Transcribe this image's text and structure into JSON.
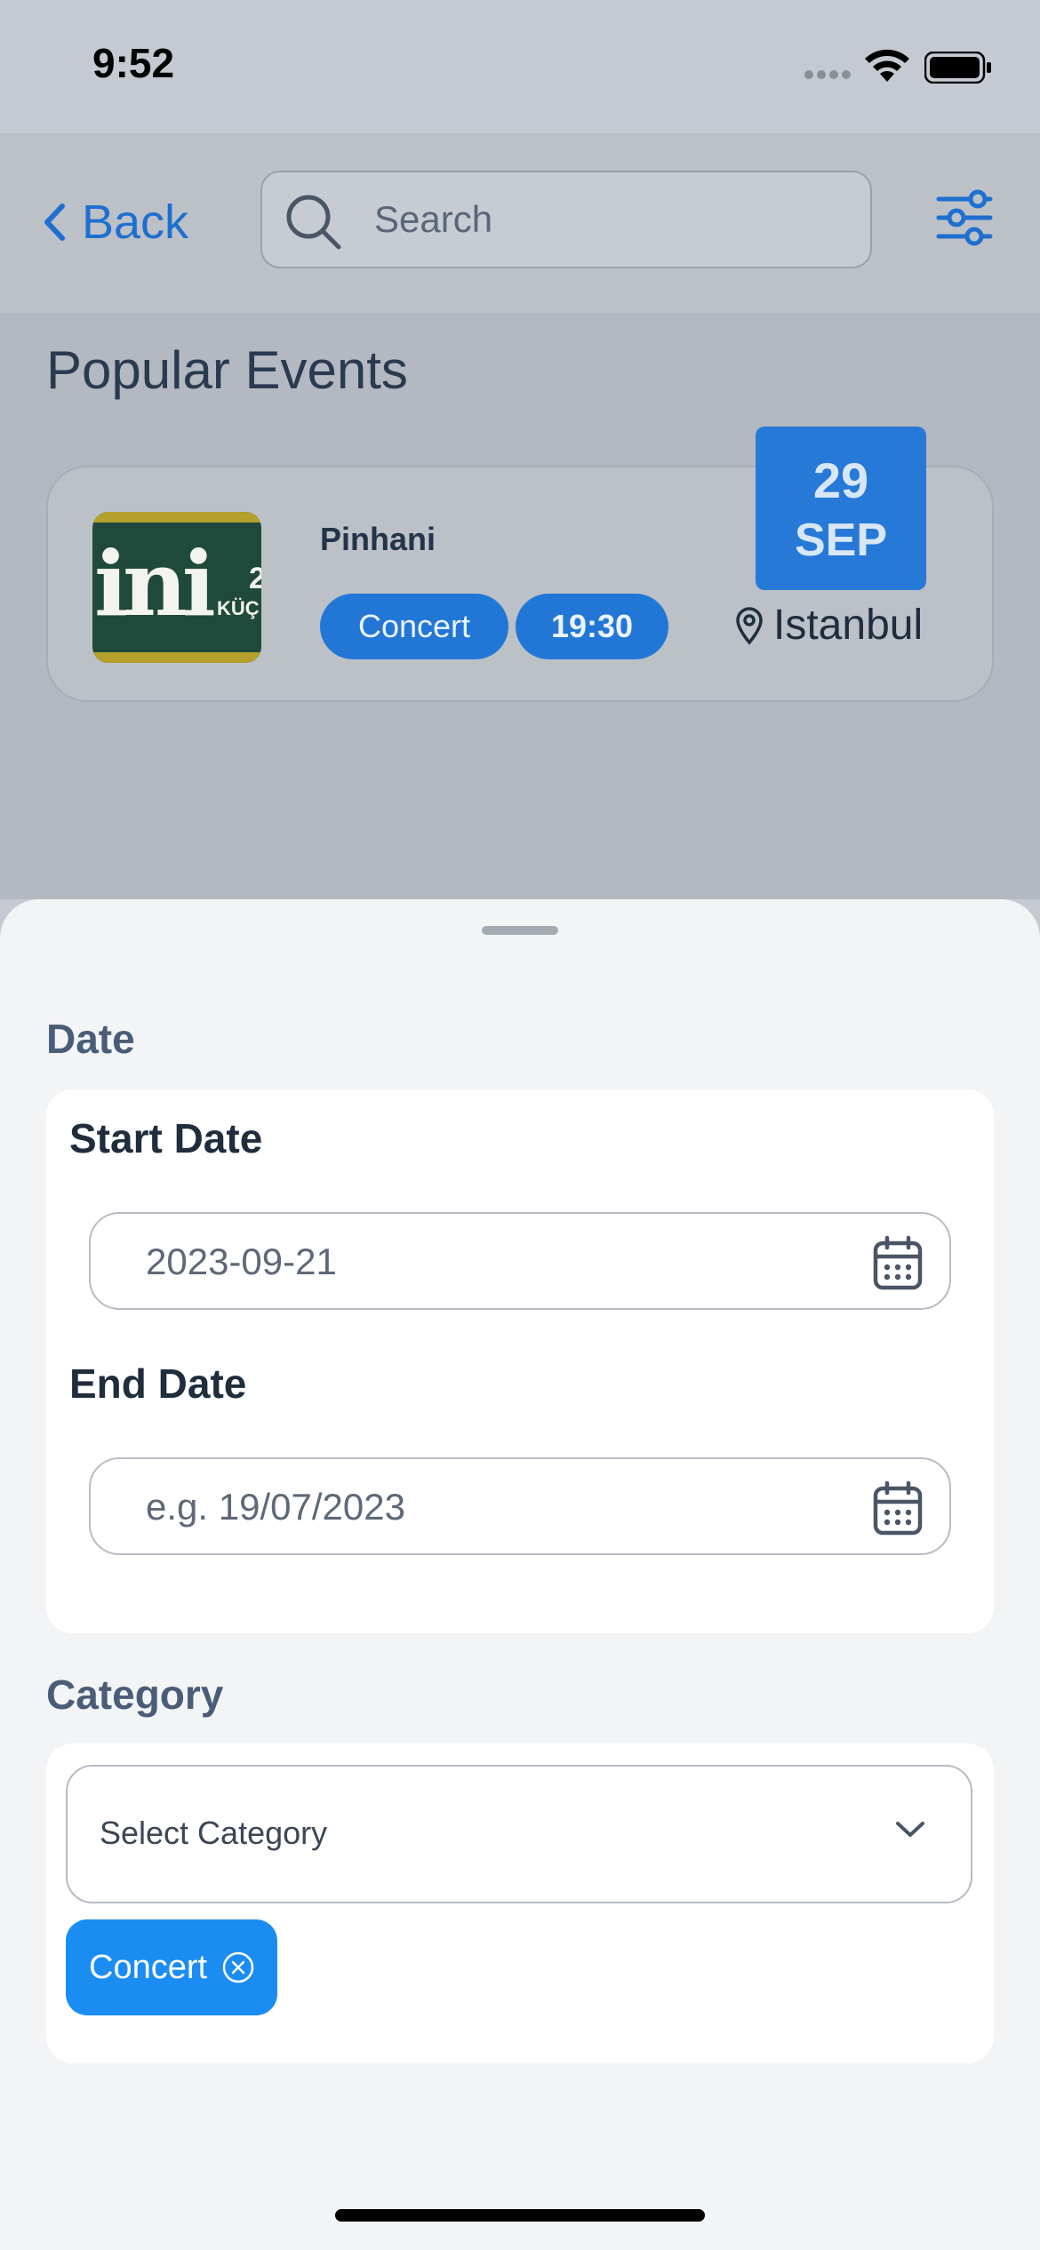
{
  "status_bar": {
    "time": "9:52"
  },
  "nav": {
    "back_label": "Back",
    "search_placeholder": "Search"
  },
  "content": {
    "section_title": "Popular Events",
    "event": {
      "name": "Pinhani",
      "category": "Concert",
      "time": "19:30",
      "day": "29",
      "month": "SEP",
      "location": "Istanbul",
      "thumbnail": {
        "logo_text": "ini",
        "number_text": "2",
        "small_text": "KÜÇ"
      }
    }
  },
  "sheet": {
    "date_section_label": "Date",
    "start_date": {
      "label": "Start Date",
      "value": "2023-09-21"
    },
    "end_date": {
      "label": "End Date",
      "placeholder": "e.g. 19/07/2023"
    },
    "category_section_label": "Category",
    "category_select": {
      "placeholder": "Select Category"
    },
    "selected_tags": [
      "Concert"
    ]
  },
  "colors": {
    "accent": "#1e6fd0",
    "badge_blue": "#2779d8",
    "tag_blue": "#1b8df2",
    "sheet_bg": "#f3f4f6"
  }
}
